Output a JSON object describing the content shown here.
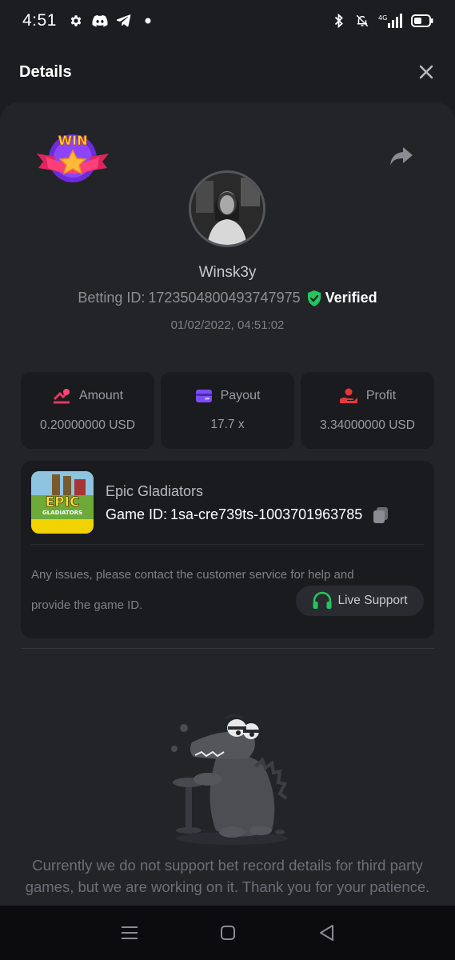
{
  "status_bar": {
    "time": "4:51",
    "left_icons": [
      "gear-icon",
      "discord-icon",
      "telegram-icon",
      "dot-icon"
    ],
    "right_icons": [
      "bluetooth-icon",
      "mute-icon",
      "signal-4g-icon",
      "battery-icon"
    ]
  },
  "header": {
    "title": "Details",
    "close_icon": "close-icon"
  },
  "bet": {
    "badge_text": "WIN",
    "username": "Winsk3y",
    "betting_id_label": "Betting ID:",
    "betting_id": "1723504800493747975",
    "verified_label": "Verified",
    "date": "01/02/2022, 04:51:02"
  },
  "stats": [
    {
      "label": "Amount",
      "value": "0.20000000 USD",
      "icon": "amount-icon",
      "color": "#e8365d"
    },
    {
      "label": "Payout",
      "value": "17.7 x",
      "icon": "payout-card-icon",
      "color": "#7c4dff"
    },
    {
      "label": "Profit",
      "value": "3.34000000 USD",
      "icon": "profit-hand-icon",
      "color": "#e53935"
    }
  ],
  "game": {
    "name": "Epic Gladiators",
    "id_label": "Game ID:",
    "id": "1sa-cre739ts-1003701963785",
    "thumb_title": "EPIC",
    "thumb_subtitle": "GLADIATORS",
    "issues_line1": "Any issues, please contact the customer service for help and",
    "issues_line2": "provide the game ID.",
    "support_label": "Live Support"
  },
  "notice": "Currently we do not support bet record details for third party games, but we are working on it. Thank you for your patience.",
  "colors": {
    "background": "#1c1d21",
    "card": "#1a1b1f",
    "verified_green": "#22c55e",
    "support_green": "#22c55e"
  },
  "nav": [
    "menu-icon",
    "home-icon",
    "back-icon"
  ]
}
